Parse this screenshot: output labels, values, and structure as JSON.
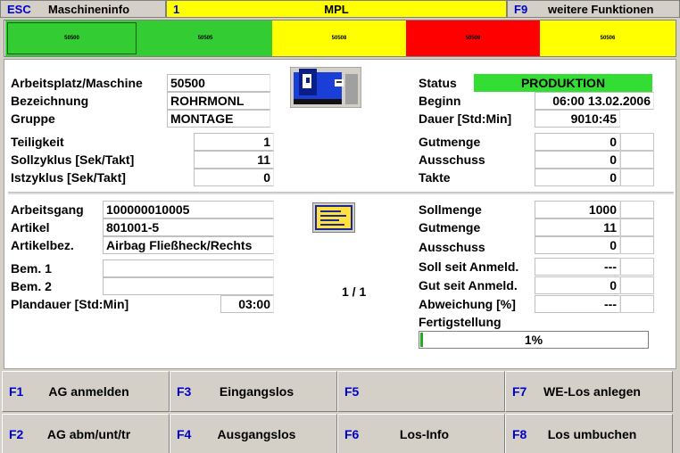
{
  "top_bar": {
    "esc_key": "ESC",
    "esc_label": "Maschineninfo",
    "mid_key": "1",
    "mid_label": "MPL",
    "f9_key": "F9",
    "f9_label": "weitere Funktionen"
  },
  "machines": [
    {
      "id": "50500",
      "color": "#33cc33",
      "selected": true
    },
    {
      "id": "50505",
      "color": "#33cc33",
      "selected": false
    },
    {
      "id": "50508",
      "color": "#ffff00",
      "selected": false
    },
    {
      "id": "50509",
      "color": "#ff0000",
      "selected": false
    },
    {
      "id": "50506",
      "color": "#ffff00",
      "selected": false
    }
  ],
  "machine_info": {
    "workplace_label": "Arbeitsplatz/Maschine",
    "workplace_value": "50500",
    "designation_label": "Bezeichnung",
    "designation_value": "ROHRMONL",
    "group_label": "Gruppe",
    "group_value": "MONTAGE",
    "parts_label": "Teiligkeit",
    "parts_value": "1",
    "target_cycle_label": "Sollzyklus [Sek/Takt]",
    "target_cycle_value": "11",
    "actual_cycle_label": "Istzyklus  [Sek/Takt]",
    "actual_cycle_value": "0",
    "machine_icon": "machine-icon"
  },
  "status": {
    "status_label": "Status",
    "status_value": "PRODUKTION",
    "status_color": "#33dd33",
    "begin_label": "Beginn",
    "begin_value": "06:00  13.02.2006",
    "duration_label": "Dauer [Std:Min]",
    "duration_value": "9010:45",
    "good_label": "Gutmenge",
    "good_value": "0",
    "scrap_label": "Ausschuss",
    "scrap_value": "0",
    "cycles_label": "Takte",
    "cycles_value": "0"
  },
  "operation": {
    "op_label": "Arbeitsgang",
    "op_value": "100000010005",
    "article_label": "Artikel",
    "article_value": "801001-5",
    "article_desc_label": "Artikelbez.",
    "article_desc_value": "Airbag Fließheck/Rechts",
    "rem1_label": "Bem. 1",
    "rem1_value": "",
    "rem2_label": "Bem. 2",
    "rem2_value": "",
    "planned_label": "Plandauer [Std:Min]",
    "planned_value": "03:00",
    "document_icon": "document-icon",
    "pager": "1 / 1"
  },
  "quantities": {
    "target_label": "Sollmenge",
    "target_value": "1000",
    "good_label": "Gutmenge",
    "good_value": "11",
    "scrap_label": "Ausschuss",
    "scrap_value": "0",
    "target_since_label": "Soll seit Anmeld.",
    "target_since_value": "---",
    "good_since_label": "Gut seit Anmeld.",
    "good_since_value": "0",
    "deviation_label": "Abweichung [%]",
    "deviation_value": "---",
    "completion_label": "Fertigstellung",
    "completion_text": "1%",
    "completion_fraction": 0.01
  },
  "function_keys": [
    {
      "key": "F1",
      "label": "AG anmelden",
      "enabled": true
    },
    {
      "key": "F3",
      "label": "Eingangslos",
      "enabled": true
    },
    {
      "key": "F5",
      "label": "",
      "enabled": false
    },
    {
      "key": "F7",
      "label": "WE-Los anlegen",
      "enabled": true
    },
    {
      "key": "F2",
      "label": "AG abm/unt/tr",
      "enabled": true
    },
    {
      "key": "F4",
      "label": "Ausgangslos",
      "enabled": true
    },
    {
      "key": "F6",
      "label": "Los-Info",
      "enabled": true
    },
    {
      "key": "F8",
      "label": "Los umbuchen",
      "enabled": true
    }
  ]
}
